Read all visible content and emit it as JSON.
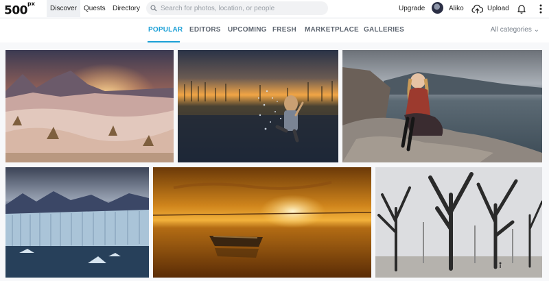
{
  "header": {
    "logo_text": "500",
    "logo_sup": "px",
    "nav": [
      "Discover",
      "Quests",
      "Directory"
    ],
    "search_placeholder": "Search for photos, location, or people",
    "upgrade_label": "Upgrade",
    "username": "Aliko",
    "upload_label": "Upload",
    "icons": [
      "search-icon",
      "upload-cloud-icon",
      "bell-icon",
      "more-vertical-icon"
    ]
  },
  "tabs": {
    "items": [
      "POPULAR",
      "EDITORS",
      "UPCOMING",
      "FRESH",
      "MARKETPLACE",
      "GALLERIES"
    ],
    "active": "POPULAR",
    "categories_label": "All categories",
    "accent_color": "#1a9fd6"
  },
  "gallery": {
    "photos": [
      "snowy-mountain-sunset",
      "child-splashing-water-at-sunset",
      "woman-sitting-on-rock-by-sea",
      "glacier-and-icebergs",
      "boat-on-golden-lake-sunset",
      "bare-trees-in-fog"
    ]
  }
}
